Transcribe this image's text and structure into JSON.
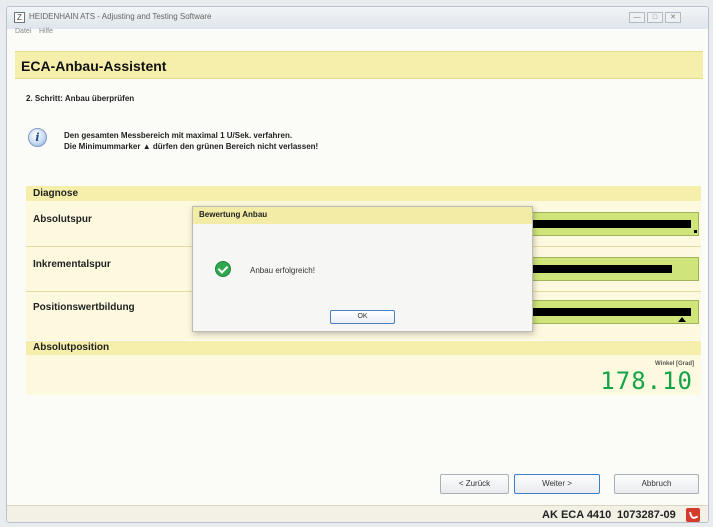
{
  "window": {
    "title": "HEIDENHAIN ATS - Adjusting and Testing Software",
    "icon_letter": "Z",
    "controls": [
      "minimize-icon",
      "maximize-icon",
      "close-icon"
    ]
  },
  "menu": {
    "items": [
      "Datei",
      "Hilfe"
    ]
  },
  "header": {
    "title": "ECA-Anbau-Assistent"
  },
  "step": {
    "text": "2. Schritt: Anbau überprüfen"
  },
  "instructions": {
    "icon_letter": "i",
    "line1": "Den gesamten Messbereich mit maximal 1 U/Sek. verfahren.",
    "line2": "Die Minimummarker ▲ dürfen den grünen Bereich nicht verlassen!"
  },
  "diagnose": {
    "title": "Diagnose",
    "rows": [
      {
        "label": "Absolutspur",
        "level": 0.99,
        "marker": "dot"
      },
      {
        "label": "Inkrementalspur",
        "level": 0.95,
        "marker": "none"
      },
      {
        "label": "Positionswertbildung",
        "level": 0.99,
        "marker": "triangle"
      }
    ],
    "colors": {
      "green_zone": "#cfe57a",
      "bar": "#000000"
    }
  },
  "absolute_position": {
    "title": "Absolutposition",
    "unit_label": "Winkel [Grad]",
    "value": "178.10",
    "value_color": "#15a34a"
  },
  "dialog": {
    "title": "Bewertung Anbau",
    "message": "Anbau erfolgreich!",
    "ok_label": "OK",
    "icon": "check-icon"
  },
  "buttons": {
    "back": "< Zurück",
    "next": "Weiter >",
    "cancel": "Abbruch"
  },
  "status": {
    "model": "AK ECA 4410",
    "serial": "1073287-09",
    "icon": "status-icon"
  }
}
